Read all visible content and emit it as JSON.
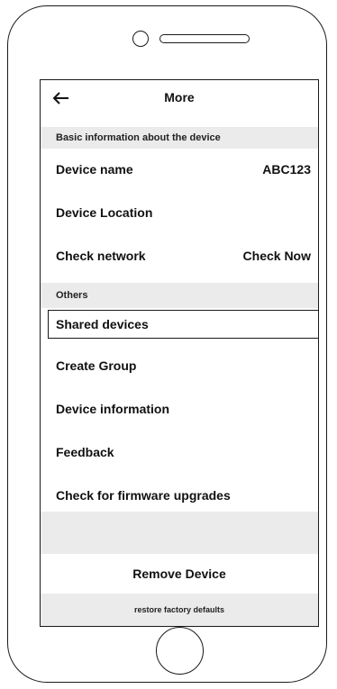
{
  "header": {
    "back_icon": "arrow-left-icon",
    "title": "More"
  },
  "sections": {
    "basic": "Basic information about the device",
    "others": "Others"
  },
  "basic_rows": {
    "device_name_label": "Device name",
    "device_name_value": "ABC123",
    "device_location_label": "Device Location",
    "check_network_label": "Check network",
    "check_network_action": "Check Now"
  },
  "other_rows": {
    "shared_devices": "Shared devices",
    "create_group": "Create Group",
    "device_information": "Device information",
    "feedback": "Feedback",
    "firmware_upgrades": "Check for firmware upgrades"
  },
  "actions": {
    "remove_device": "Remove Device",
    "restore_factory": "restore factory defaults"
  }
}
